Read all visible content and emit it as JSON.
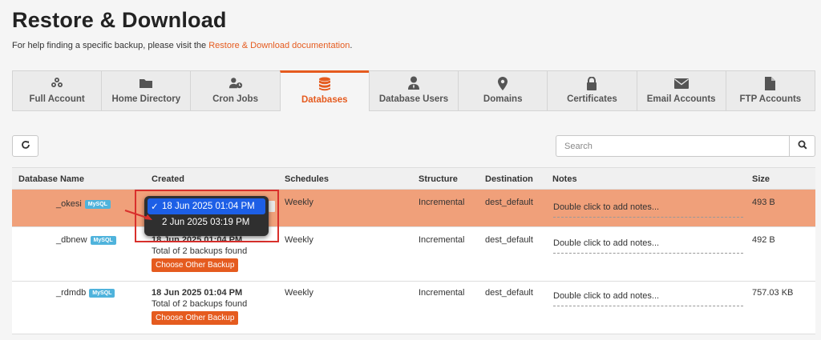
{
  "page": {
    "title": "Restore & Download",
    "help_prefix": "For help finding a specific backup, please visit the ",
    "help_link": "Restore & Download documentation",
    "help_suffix": "."
  },
  "tabs": [
    {
      "label": "Full Account",
      "icon": "users-icon"
    },
    {
      "label": "Home Directory",
      "icon": "folder-icon"
    },
    {
      "label": "Cron Jobs",
      "icon": "user-clock-icon"
    },
    {
      "label": "Databases",
      "icon": "database-icon",
      "active": true
    },
    {
      "label": "Database Users",
      "icon": "user-tie-icon"
    },
    {
      "label": "Domains",
      "icon": "map-marker-icon"
    },
    {
      "label": "Certificates",
      "icon": "lock-icon"
    },
    {
      "label": "Email Accounts",
      "icon": "envelope-icon"
    },
    {
      "label": "FTP Accounts",
      "icon": "file-icon"
    }
  ],
  "search": {
    "placeholder": "Search"
  },
  "table": {
    "headers": {
      "name": "Database Name",
      "created": "Created",
      "schedules": "Schedules",
      "structure": "Structure",
      "destination": "Destination",
      "notes": "Notes",
      "size": "Size"
    },
    "rows": [
      {
        "name": "_okesi",
        "badge": "MySQL",
        "created": "",
        "backups": "",
        "button": "",
        "schedule": "Weekly",
        "structure": "Incremental",
        "destination": "dest_default",
        "notes": "Double click to add notes...",
        "size": "493 B"
      },
      {
        "name": "_dbnew",
        "badge": "MySQL",
        "created": "18 Jun 2025 01:04 PM",
        "backups": "Total of 2 backups found",
        "button": "Choose Other Backup",
        "schedule": "Weekly",
        "structure": "Incremental",
        "destination": "dest_default",
        "notes": "Double click to add notes...",
        "size": "492 B"
      },
      {
        "name": "_rdmdb",
        "badge": "MySQL",
        "created": "18 Jun 2025 01:04 PM",
        "backups": "Total of 2 backups found",
        "button": "Choose Other Backup",
        "schedule": "Weekly",
        "structure": "Incremental",
        "destination": "dest_default",
        "notes": "Double click to add notes...",
        "size": "757.03 KB"
      }
    ]
  },
  "dropdown": {
    "options": [
      {
        "label": "18 Jun 2025 01:04 PM",
        "selected": true,
        "check": "✓"
      },
      {
        "label": "2 Jun 2025 03:19 PM",
        "selected": false,
        "check": ""
      }
    ]
  },
  "colors": {
    "accent": "#e55b1f",
    "selected_row": "#f0a07a",
    "badge": "#4fb3dc",
    "highlight": "#d9302c"
  }
}
